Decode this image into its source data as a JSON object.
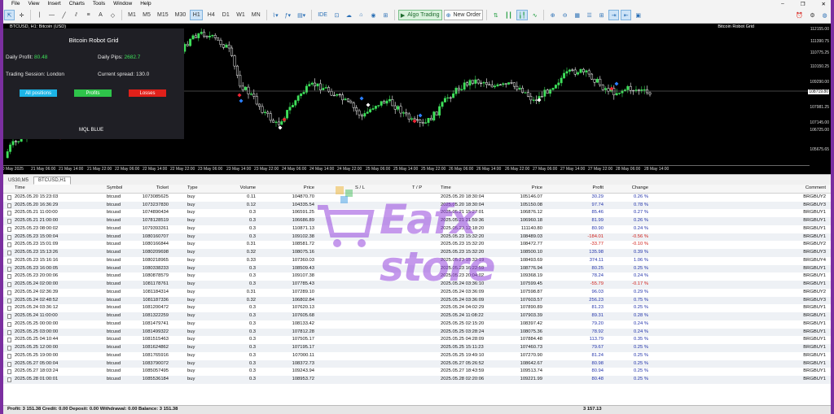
{
  "menu": [
    "File",
    "View",
    "Insert",
    "Charts",
    "Tools",
    "Window",
    "Help"
  ],
  "toolbar": {
    "timeframes": [
      "M1",
      "M5",
      "M15",
      "M30",
      "H1",
      "H4",
      "D1",
      "W1",
      "MN"
    ],
    "active_timeframe": "H1",
    "ide_label": "IDE",
    "algo_label": "Algo Trading",
    "new_order_label": "New Order"
  },
  "chart": {
    "title": "BTCUSD, H1: Bitcoin (USD)",
    "indicator": "Bitcoin Robot Grid",
    "price_labels": [
      "112155.00",
      "111390.75",
      "110775.25",
      "110150.25",
      "109290.00",
      "108719.80",
      "107981.25",
      "107145.00",
      "106725.00",
      "105675.65"
    ],
    "current_price": "108719.80",
    "time_labels": [
      "20 May 2025",
      "21 May 06:00",
      "21 May 14:00",
      "21 May 22:00",
      "22 May 06:00",
      "22 May 14:00",
      "22 May 22:00",
      "23 May 06:00",
      "23 May 14:00",
      "23 May 22:00",
      "24 May 06:00",
      "24 May 14:00",
      "24 May 22:00",
      "25 May 06:00",
      "25 May 14:00",
      "25 May 22:00",
      "26 May 06:00",
      "26 May 14:00",
      "26 May 22:00",
      "27 May 06:00",
      "27 May 14:00",
      "27 May 22:00",
      "28 May 06:00",
      "28 May 14:00"
    ],
    "panel": {
      "title": "Bitcoin Robot Grid",
      "daily_profit_label": "Daily Profit:",
      "daily_profit_value": "80.48",
      "daily_pips_label": "Daily Pips:",
      "daily_pips_value": "2682.7",
      "session_label": "Trading Session: London",
      "spread_label": "Current spread:",
      "spread_value": "130.0",
      "btn_all": "All positions",
      "btn_profits": "Profits",
      "btn_losses": "Losses",
      "brand": "MQL BLUE"
    }
  },
  "tabs": [
    "US30,M5",
    "BTCUSD,H1"
  ],
  "active_tab": "BTCUSD,H1",
  "table": {
    "headers": [
      "Time",
      "Symbol",
      "Ticket",
      "Type",
      "Volume",
      "Price",
      "S / L",
      "T / P",
      "Time",
      "Price",
      "Profit",
      "Change",
      "Comment"
    ],
    "rows": [
      [
        "2025.05.20 15:23:03",
        "btcusd",
        "1073085625",
        "buy",
        "0.11",
        "104870.70",
        "",
        "",
        "2025.05.20 18:30:04",
        "105146.07",
        "30.29",
        "0.26 %",
        "BRGBUY2"
      ],
      [
        "2025.05.20 16:36:29",
        "btcusd",
        "1073237830",
        "buy",
        "0.12",
        "104335.54",
        "",
        "",
        "2025.05.20 18:30:04",
        "105150.08",
        "97.74",
        "0.78 %",
        "BRGBUY3"
      ],
      [
        "2025.05.21 11:00:00",
        "btcusd",
        "1074890434",
        "buy",
        "0.3",
        "106591.25",
        "",
        "",
        "2025.05.21 15:27:01",
        "106876.12",
        "85.46",
        "0.27 %",
        "BRGBUY1"
      ],
      [
        "2025.05.21 21:00:00",
        "btcusd",
        "1078128519",
        "buy",
        "0.3",
        "106686.89",
        "",
        "",
        "2025.05.21 21:59:36",
        "106960.18",
        "81.99",
        "0.26 %",
        "BRGBUY1"
      ],
      [
        "2025.05.23 08:00:02",
        "btcusd",
        "1079393261",
        "buy",
        "0.3",
        "110871.13",
        "",
        "",
        "2025.05.23 12:18:20",
        "111140.80",
        "80.90",
        "0.24 %",
        "BRGBUY1"
      ],
      [
        "2025.05.23 15:00:04",
        "btcusd",
        "1080160707",
        "buy",
        "0.3",
        "109102.38",
        "",
        "",
        "2025.05.23 15:32:20",
        "108489.03",
        "-184.01",
        "-0.56 %",
        "BRGBUY1"
      ],
      [
        "2025.05.23 15:01:09",
        "btcusd",
        "1080166844",
        "buy",
        "0.31",
        "108581.72",
        "",
        "",
        "2025.05.23 15:32:20",
        "108472.77",
        "-33.77",
        "-0.10 %",
        "BRGBUY2"
      ],
      [
        "2025.05.23 15:13:26",
        "btcusd",
        "1080209698",
        "buy",
        "0.32",
        "108075.16",
        "",
        "",
        "2025.05.23 15:32:20",
        "108500.10",
        "135.98",
        "0.39 %",
        "BRGBUY3"
      ],
      [
        "2025.05.23 15:16:16",
        "btcusd",
        "1080218965",
        "buy",
        "0.33",
        "107360.03",
        "",
        "",
        "2025.05.23 15:32:19",
        "108493.69",
        "374.11",
        "1.06 %",
        "BRGBUY4"
      ],
      [
        "2025.05.23 16:00:05",
        "btcusd",
        "1080338233",
        "buy",
        "0.3",
        "108509.43",
        "",
        "",
        "2025.05.23 16:22:59",
        "108776.94",
        "80.25",
        "0.25 %",
        "BRGBUY1"
      ],
      [
        "2025.05.23 20:00:06",
        "btcusd",
        "1080878579",
        "buy",
        "0.3",
        "109107.38",
        "",
        "",
        "2025.05.23 20:04:02",
        "109368.19",
        "78.24",
        "0.24 %",
        "BRGBUY1"
      ],
      [
        "2025.05.24 02:00:00",
        "btcusd",
        "1081178761",
        "buy",
        "0.3",
        "107785.43",
        "",
        "",
        "2025.05.24 03:36:10",
        "107599.45",
        "-55.79",
        "-0.17 %",
        "BRGBUY1"
      ],
      [
        "2025.05.24 02:36:39",
        "btcusd",
        "1081184314",
        "buy",
        "0.31",
        "107289.10",
        "",
        "",
        "2025.05.24 03:36:09",
        "107598.87",
        "96.03",
        "0.29 %",
        "BRGBUY2"
      ],
      [
        "2025.05.24 02:48:52",
        "btcusd",
        "1081187336",
        "buy",
        "0.32",
        "106802.84",
        "",
        "",
        "2025.05.24 03:36:09",
        "107603.57",
        "256.23",
        "0.75 %",
        "BRGBUY3"
      ],
      [
        "2025.05.24 03:36:12",
        "btcusd",
        "1081200472",
        "buy",
        "0.3",
        "107620.13",
        "",
        "",
        "2025.05.24 04:02:29",
        "107890.89",
        "81.23",
        "0.25 %",
        "BRGBUY1"
      ],
      [
        "2025.05.24 11:00:00",
        "btcusd",
        "1081322259",
        "buy",
        "0.3",
        "107605.68",
        "",
        "",
        "2025.05.24 11:08:22",
        "107903.39",
        "89.31",
        "0.28 %",
        "BRGBUY1"
      ],
      [
        "2025.05.25 00:00:00",
        "btcusd",
        "1081479741",
        "buy",
        "0.3",
        "108133.42",
        "",
        "",
        "2025.05.25 02:15:20",
        "108397.42",
        "79.20",
        "0.24 %",
        "BRGBUY1"
      ],
      [
        "2025.05.25 03:00:00",
        "btcusd",
        "1081499322",
        "buy",
        "0.3",
        "107812.28",
        "",
        "",
        "2025.05.25 03:28:24",
        "108075.36",
        "78.92",
        "0.24 %",
        "BRGBUY1"
      ],
      [
        "2025.05.25 04:10:44",
        "btcusd",
        "1081515463",
        "buy",
        "0.3",
        "107505.17",
        "",
        "",
        "2025.05.25 04:28:09",
        "107884.48",
        "113.79",
        "0.35 %",
        "BRGBUY1"
      ],
      [
        "2025.05.25 12:00:00",
        "btcusd",
        "1081624862",
        "buy",
        "0.3",
        "107195.17",
        "",
        "",
        "2025.05.25 15:11:23",
        "107460.73",
        "79.67",
        "0.25 %",
        "BRGBUY1"
      ],
      [
        "2025.05.25 19:00:00",
        "btcusd",
        "1081765916",
        "buy",
        "0.3",
        "107000.11",
        "",
        "",
        "2025.05.25 19:49:10",
        "107270.90",
        "81.24",
        "0.25 %",
        "BRGBUY1"
      ],
      [
        "2025.05.27 05:00:04",
        "btcusd",
        "1083790072",
        "buy",
        "0.3",
        "108372.73",
        "",
        "",
        "2025.05.27 05:26:52",
        "108642.67",
        "80.98",
        "0.25 %",
        "BRGBUY1"
      ],
      [
        "2025.05.27 18:03:24",
        "btcusd",
        "1085057495",
        "buy",
        "0.3",
        "109243.94",
        "",
        "",
        "2025.05.27 18:43:59",
        "109513.74",
        "80.94",
        "0.25 %",
        "BRGBUY1"
      ],
      [
        "2025.05.28 01:00:01",
        "btcusd",
        "1085536184",
        "buy",
        "0.3",
        "108953.72",
        "",
        "",
        "2025.05.28 02:20:06",
        "109221.99",
        "80.48",
        "0.25 %",
        "BRGBUY1"
      ]
    ]
  },
  "status": {
    "summary": "Profit: 3 151.38  Credit: 0.00  Deposit: 0.00  Withdrawal: 0.00  Balance: 3 151.38",
    "total": "3 157.13"
  },
  "watermark": "Eafx store",
  "colors": {
    "chart_bg": "#000000",
    "bull_candle": "#3ee05a",
    "bear_candle": "#ffffff",
    "profit_text": "#2233aa",
    "loss_text": "#d0201a",
    "frame": "#7b2fa0"
  }
}
